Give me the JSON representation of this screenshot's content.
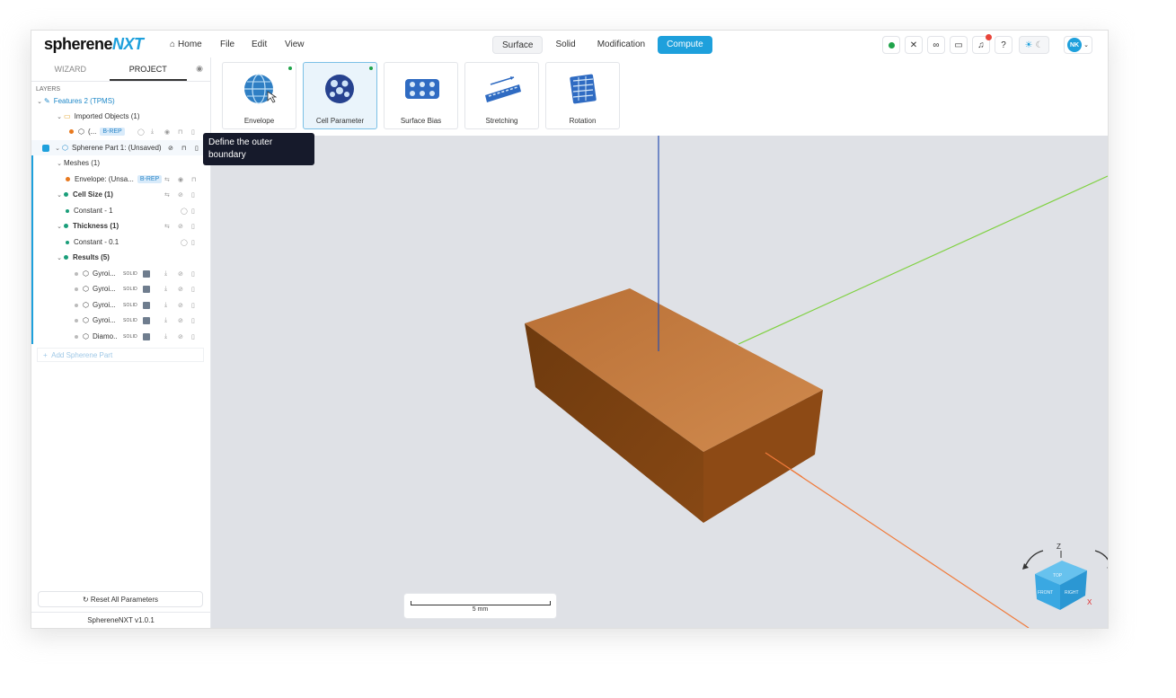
{
  "app": {
    "logo_main": "sphere",
    "logo_mid": "ne",
    "logo_accent": "NXT"
  },
  "menu": {
    "home": "Home",
    "file": "File",
    "edit": "Edit",
    "view": "View"
  },
  "modes": [
    "Surface",
    "Solid",
    "Modification",
    "Compute"
  ],
  "user": {
    "initials": "NK"
  },
  "sidebar": {
    "tab_wizard": "WIZARD",
    "tab_project": "PROJECT",
    "layers_label": "LAYERS",
    "features": "Features 2 (TPMS)",
    "imported": "Imported Objects (1)",
    "imported_item": "(...",
    "brep": "B-REP",
    "part": "Spherene Part 1: (Unsaved)",
    "meshes": "Meshes (1)",
    "envelope_item": "Envelope: (Unsa...",
    "cell_size": "Cell Size (1)",
    "constant1": "Constant - 1",
    "thickness": "Thickness (1)",
    "constant01": "Constant - 0.1",
    "results": "Results (5)",
    "result_items": [
      "Gyroi...",
      "Gyroi...",
      "Gyroi...",
      "Gyroi...",
      "Diamo..."
    ],
    "solid_tag": "SOLID",
    "add_part": "Add Spherene Part",
    "reset": "Reset All Parameters",
    "version": "SphereneNXT v1.0.1"
  },
  "ribbon": [
    "Envelope",
    "Cell Parameter",
    "Surface Bias",
    "Stretching",
    "Rotation"
  ],
  "tooltip": "Define the outer boundary",
  "scale_label": "5 mm",
  "navcube": {
    "z": "Z",
    "x": "X",
    "top": "TOP",
    "front": "FRONT",
    "right": "RIGHT"
  },
  "colors": {
    "accent": "#1ea0dc",
    "box_top": "#c07a3e",
    "box_front": "#7a3f10"
  }
}
